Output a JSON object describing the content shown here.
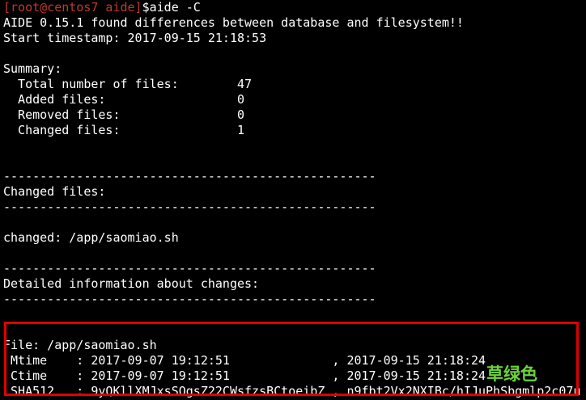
{
  "prompt": {
    "user_host": "[root@centos7 aide]",
    "symbol": "$",
    "command": "aide -C"
  },
  "output": {
    "found_line": "AIDE 0.15.1 found differences between database and filesystem!!",
    "timestamp_line": "Start timestamp: 2017-09-15 21:18:53",
    "summary_heading": "Summary:",
    "summary_rows": [
      "  Total number of files:        47",
      "  Added files:                  0",
      "  Removed files:                0",
      "  Changed files:                1"
    ],
    "separator": "---------------------------------------------------",
    "changed_files_heading": "Changed files:",
    "changed_entry": "changed: /app/saomiao.sh",
    "detailed_heading": "Detailed information about changes:",
    "file_line": "File: /app/saomiao.sh",
    "detail_rows": [
      " Mtime    : 2017-09-07 19:12:51              , 2017-09-15 21:18:24",
      " Ctime    : 2017-09-07 19:12:51              , 2017-09-15 21:18:24",
      " SHA512   : 9yQKllXMJxsSOgsZ22CWsfzsBCtoeibZ , n9fbt2Vx2NXIBc/hIJuPhSbgmlp2c07u"
    ]
  },
  "watermark": "草绿色",
  "colors": {
    "background": "#000000",
    "text": "#ffffff",
    "prompt": "#c0392b",
    "highlight_border": "#e00000",
    "watermark": "#6cd43a"
  }
}
